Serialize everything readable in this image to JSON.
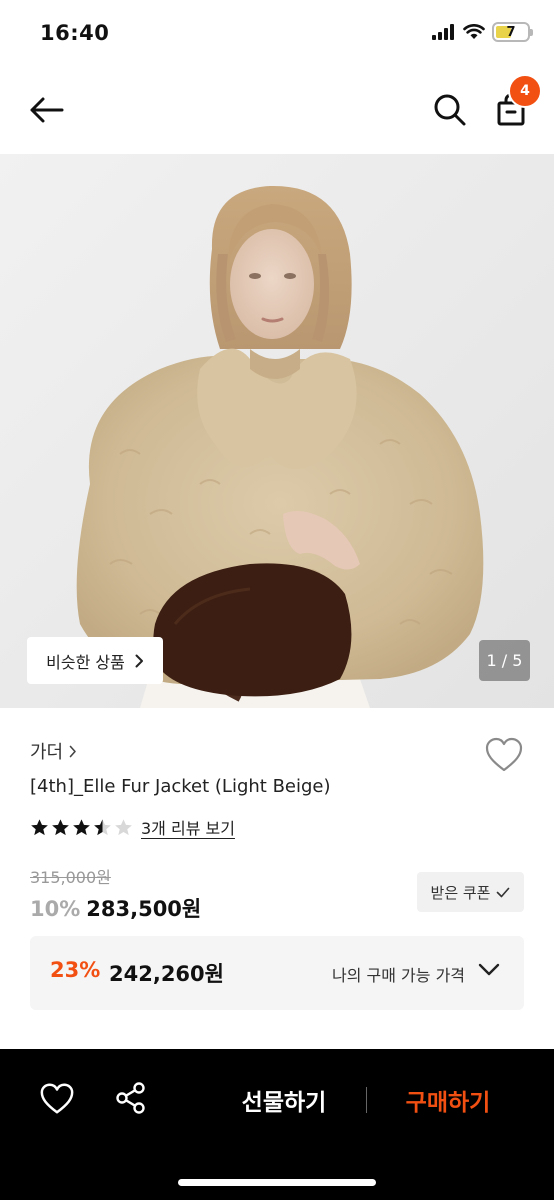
{
  "status_bar": {
    "time": "16:40",
    "battery": "7"
  },
  "nav": {
    "cart_count": "4",
    "icons": [
      "back-arrow-icon",
      "search-icon",
      "cart-icon"
    ]
  },
  "image": {
    "similar_label": "비슷한 상품",
    "counter": "1 / 5"
  },
  "product": {
    "brand": "가더",
    "name": "[4th]_Elle Fur Jacket (Light Beige)",
    "rating": 3.5,
    "review_link": "3개 리뷰 보기",
    "original_price": "315,000원",
    "discount": "10%",
    "sale_price": "283,500원",
    "coupon_label": "받은 쿠폰"
  },
  "my_price": {
    "discount": "23%",
    "price": "242,260원",
    "label": "나의 구매 가능 가격"
  },
  "bottom_bar": {
    "gift_label": "선물하기",
    "buy_label": "구매하기"
  },
  "colors": {
    "accent": "#f24f12",
    "bottom_bar": "#000000"
  }
}
